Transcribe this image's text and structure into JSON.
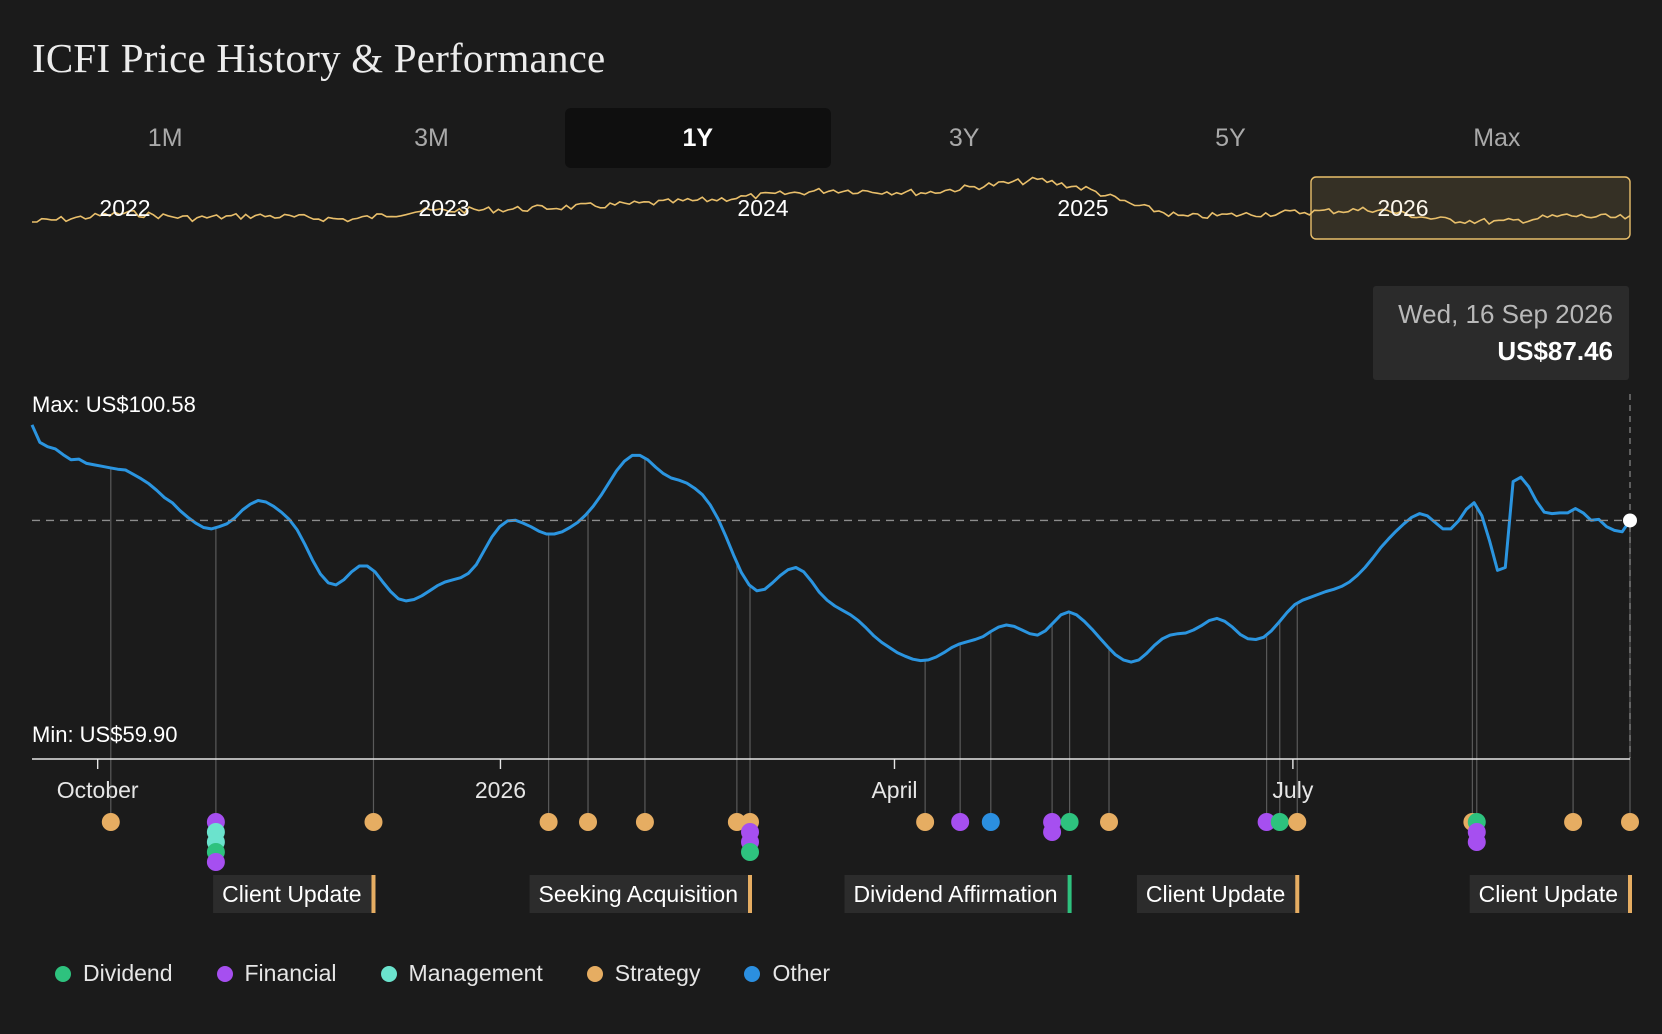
{
  "title": "ICFI Price History & Performance",
  "tabs": [
    {
      "label": "1M",
      "active": false
    },
    {
      "label": "3M",
      "active": false
    },
    {
      "label": "1Y",
      "active": true
    },
    {
      "label": "3Y",
      "active": false
    },
    {
      "label": "5Y",
      "active": false
    },
    {
      "label": "Max",
      "active": false
    }
  ],
  "tooltip": {
    "date": "Wed, 16 Sep 2026",
    "price": "US$87.46"
  },
  "colors": {
    "line": "#2b95e0",
    "overview": "#e9bf6b",
    "dividend": "#2ec27e",
    "financial": "#a64ff0",
    "management": "#6be3cd",
    "strategy": "#e6ad62",
    "other": "#2b8fe0"
  },
  "legend": [
    {
      "name": "Dividend",
      "key": "dividend"
    },
    {
      "name": "Financial",
      "key": "financial"
    },
    {
      "name": "Management",
      "key": "management"
    },
    {
      "name": "Strategy",
      "key": "strategy"
    },
    {
      "name": "Other",
      "key": "other"
    }
  ],
  "chart_data": {
    "type": "line",
    "overview": {
      "year_labels": [
        "2022",
        "2023",
        "2024",
        "2025",
        "2026"
      ],
      "selected_range": "2026"
    },
    "max_label": "Max: US$100.58",
    "min_label": "Min: US$59.90",
    "ylim": [
      59.9,
      100.58
    ],
    "reference_value": 87.46,
    "x_tick_labels": [
      "October",
      "2026",
      "April",
      "July"
    ],
    "series": [
      {
        "x_start": "2025-09-16",
        "x_end": "2026-09-16",
        "values": [
          100.6,
          98.2,
          97.6,
          97.3,
          96.5,
          95.8,
          95.9,
          95.3,
          95.1,
          94.9,
          94.7,
          94.5,
          94.4,
          93.8,
          93.2,
          92.5,
          91.6,
          90.6,
          89.9,
          88.8,
          87.9,
          87.1,
          86.5,
          86.3,
          86.6,
          87.0,
          87.8,
          88.9,
          89.7,
          90.2,
          90.0,
          89.4,
          88.6,
          87.6,
          86.2,
          84.2,
          82.0,
          80.1,
          78.9,
          78.6,
          79.3,
          80.4,
          81.2,
          81.2,
          80.4,
          79.0,
          77.7,
          76.7,
          76.4,
          76.6,
          77.1,
          77.8,
          78.5,
          79.0,
          79.3,
          79.6,
          80.2,
          81.4,
          83.3,
          85.2,
          86.6,
          87.4,
          87.5,
          87.1,
          86.6,
          86.0,
          85.6,
          85.6,
          85.9,
          86.5,
          87.2,
          88.2,
          89.4,
          90.9,
          92.6,
          94.3,
          95.6,
          96.4,
          96.4,
          95.8,
          94.8,
          93.9,
          93.3,
          93.0,
          92.6,
          91.9,
          91.0,
          89.6,
          87.7,
          85.3,
          82.7,
          80.3,
          78.6,
          77.8,
          78.0,
          78.9,
          79.9,
          80.7,
          81.0,
          80.4,
          79.1,
          77.6,
          76.5,
          75.7,
          75.1,
          74.5,
          73.7,
          72.7,
          71.6,
          70.7,
          70.0,
          69.3,
          68.8,
          68.4,
          68.2,
          68.3,
          68.7,
          69.3,
          70.0,
          70.5,
          70.8,
          71.1,
          71.5,
          72.2,
          72.8,
          73.1,
          72.9,
          72.4,
          71.9,
          71.7,
          72.3,
          73.4,
          74.5,
          74.9,
          74.5,
          73.6,
          72.5,
          71.3,
          70.1,
          69.0,
          68.3,
          68.0,
          68.3,
          69.2,
          70.3,
          71.2,
          71.7,
          71.9,
          72.0,
          72.4,
          73.0,
          73.7,
          74.0,
          73.6,
          72.8,
          71.8,
          71.2,
          71.1,
          71.4,
          72.3,
          73.5,
          74.8,
          75.9,
          76.5,
          76.9,
          77.3,
          77.7,
          78.0,
          78.4,
          79.0,
          79.9,
          81.0,
          82.3,
          83.7,
          84.9,
          86.0,
          87.0,
          87.9,
          88.4,
          88.1,
          87.2,
          86.3,
          86.3,
          87.4,
          89.0,
          89.9,
          88.1,
          84.6,
          80.6,
          81.0,
          92.8,
          93.4,
          92.1,
          90.1,
          88.6,
          88.4,
          88.5,
          88.5,
          89.1,
          88.5,
          87.5,
          87.6,
          86.6,
          86.1,
          85.9,
          87.5
        ]
      }
    ],
    "events": [
      {
        "date": "2025-10-04",
        "category": "strategy"
      },
      {
        "date": "2025-10-28",
        "category": "financial"
      },
      {
        "date": "2025-10-28",
        "category": "management"
      },
      {
        "date": "2025-10-28",
        "category": "management"
      },
      {
        "date": "2025-10-28",
        "category": "dividend"
      },
      {
        "date": "2025-10-28",
        "category": "financial"
      },
      {
        "date": "2025-12-03",
        "category": "strategy",
        "label": "Client Update"
      },
      {
        "date": "2026-01-12",
        "category": "strategy"
      },
      {
        "date": "2026-01-21",
        "category": "strategy"
      },
      {
        "date": "2026-02-03",
        "category": "strategy"
      },
      {
        "date": "2026-02-24",
        "category": "strategy"
      },
      {
        "date": "2026-02-27",
        "category": "strategy",
        "label": "Seeking Acquisition"
      },
      {
        "date": "2026-02-27",
        "category": "financial"
      },
      {
        "date": "2026-02-27",
        "category": "financial"
      },
      {
        "date": "2026-02-27",
        "category": "dividend"
      },
      {
        "date": "2026-04-08",
        "category": "strategy"
      },
      {
        "date": "2026-04-16",
        "category": "financial"
      },
      {
        "date": "2026-04-23",
        "category": "other"
      },
      {
        "date": "2026-05-07",
        "category": "financial"
      },
      {
        "date": "2026-05-07",
        "category": "financial"
      },
      {
        "date": "2026-05-11",
        "category": "dividend",
        "label": "Dividend Affirmation"
      },
      {
        "date": "2026-05-20",
        "category": "strategy"
      },
      {
        "date": "2026-06-25",
        "category": "financial"
      },
      {
        "date": "2026-06-28",
        "category": "dividend"
      },
      {
        "date": "2026-07-02",
        "category": "strategy",
        "label": "Client Update"
      },
      {
        "date": "2026-08-11",
        "category": "strategy"
      },
      {
        "date": "2026-08-12",
        "category": "dividend"
      },
      {
        "date": "2026-08-12",
        "category": "financial"
      },
      {
        "date": "2026-08-12",
        "category": "financial"
      },
      {
        "date": "2026-09-03",
        "category": "strategy"
      },
      {
        "date": "2026-09-16",
        "category": "strategy",
        "label": "Client Update"
      }
    ]
  }
}
